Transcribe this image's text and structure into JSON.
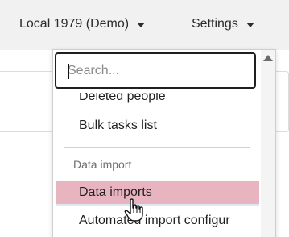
{
  "topbar": {
    "local_label": "Local 1979 (Demo)",
    "settings_label": "Settings"
  },
  "dropdown": {
    "search_placeholder": "Search...",
    "items_top": [
      {
        "label": "Deleted people"
      },
      {
        "label": "Bulk tasks list"
      }
    ],
    "section_title": "Data import",
    "section_items": [
      {
        "label": "Data imports",
        "highlighted": true
      },
      {
        "label": "Automated import configur"
      }
    ]
  },
  "colors": {
    "highlight": "#e8b4c0",
    "topbar_bg": "#f1f1f1"
  }
}
